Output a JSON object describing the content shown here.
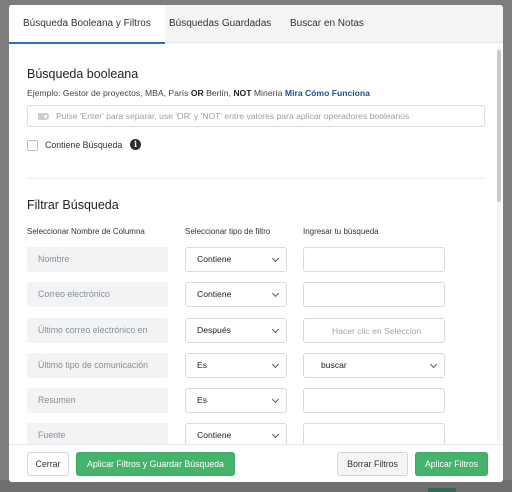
{
  "tabs": [
    {
      "label": "Búsqueda Booleana y Filtros",
      "active": true
    },
    {
      "label": "Búsquedas Guardadas",
      "active": false
    },
    {
      "label": "Buscar en Notas",
      "active": false
    }
  ],
  "boolean_section": {
    "title": "Búsqueda booleana",
    "example_prefix": "Ejemplo: Gestor de proyectos, MBA, París ",
    "example_or": "OR",
    "example_mid": " Berlín, ",
    "example_not": "NOT",
    "example_suffix": " Minería ",
    "example_link": "Mira Cómo Funciona",
    "input_placeholder": "Pulse 'Enter' para separar, use 'OR' y 'NOT' entre valores para aplicar operadores booleanos",
    "contains_label": "Contiene Búsqueda",
    "info_icon": "i"
  },
  "filter_section": {
    "title": "Filtrar Búsqueda",
    "col_name": "Seleccionar Nombre de Columna",
    "col_type": "Seleccionar tipo de filtro",
    "col_value": "Ingresar tu búsqueda",
    "rows": [
      {
        "name": "Nombre",
        "type": "Contiene",
        "value": "",
        "value_placeholder": ""
      },
      {
        "name": "Correo electrónico",
        "type": "Contiene",
        "value": "",
        "value_placeholder": ""
      },
      {
        "name": "Último correo electrónico en",
        "type": "Después",
        "value": "",
        "value_placeholder": "Hacer clic en Seleccion"
      },
      {
        "name": "Último tipo de comunicación",
        "type": "Es",
        "value_select": "buscar"
      },
      {
        "name": "Resumen",
        "type": "Es",
        "value": "",
        "value_placeholder": ""
      },
      {
        "name": "Fuente",
        "type": "Contiene",
        "value": "",
        "value_placeholder": ""
      }
    ]
  },
  "footer": {
    "close": "Cerrar",
    "apply_save": "Aplicar Filtros y Guardar Búsqueda",
    "clear": "Borrar Filtros",
    "apply": "Aplicar Filtros"
  },
  "colors": {
    "accent_blue": "#2a70c5",
    "link_blue": "#1d4f91",
    "primary_green": "#45b36b"
  }
}
